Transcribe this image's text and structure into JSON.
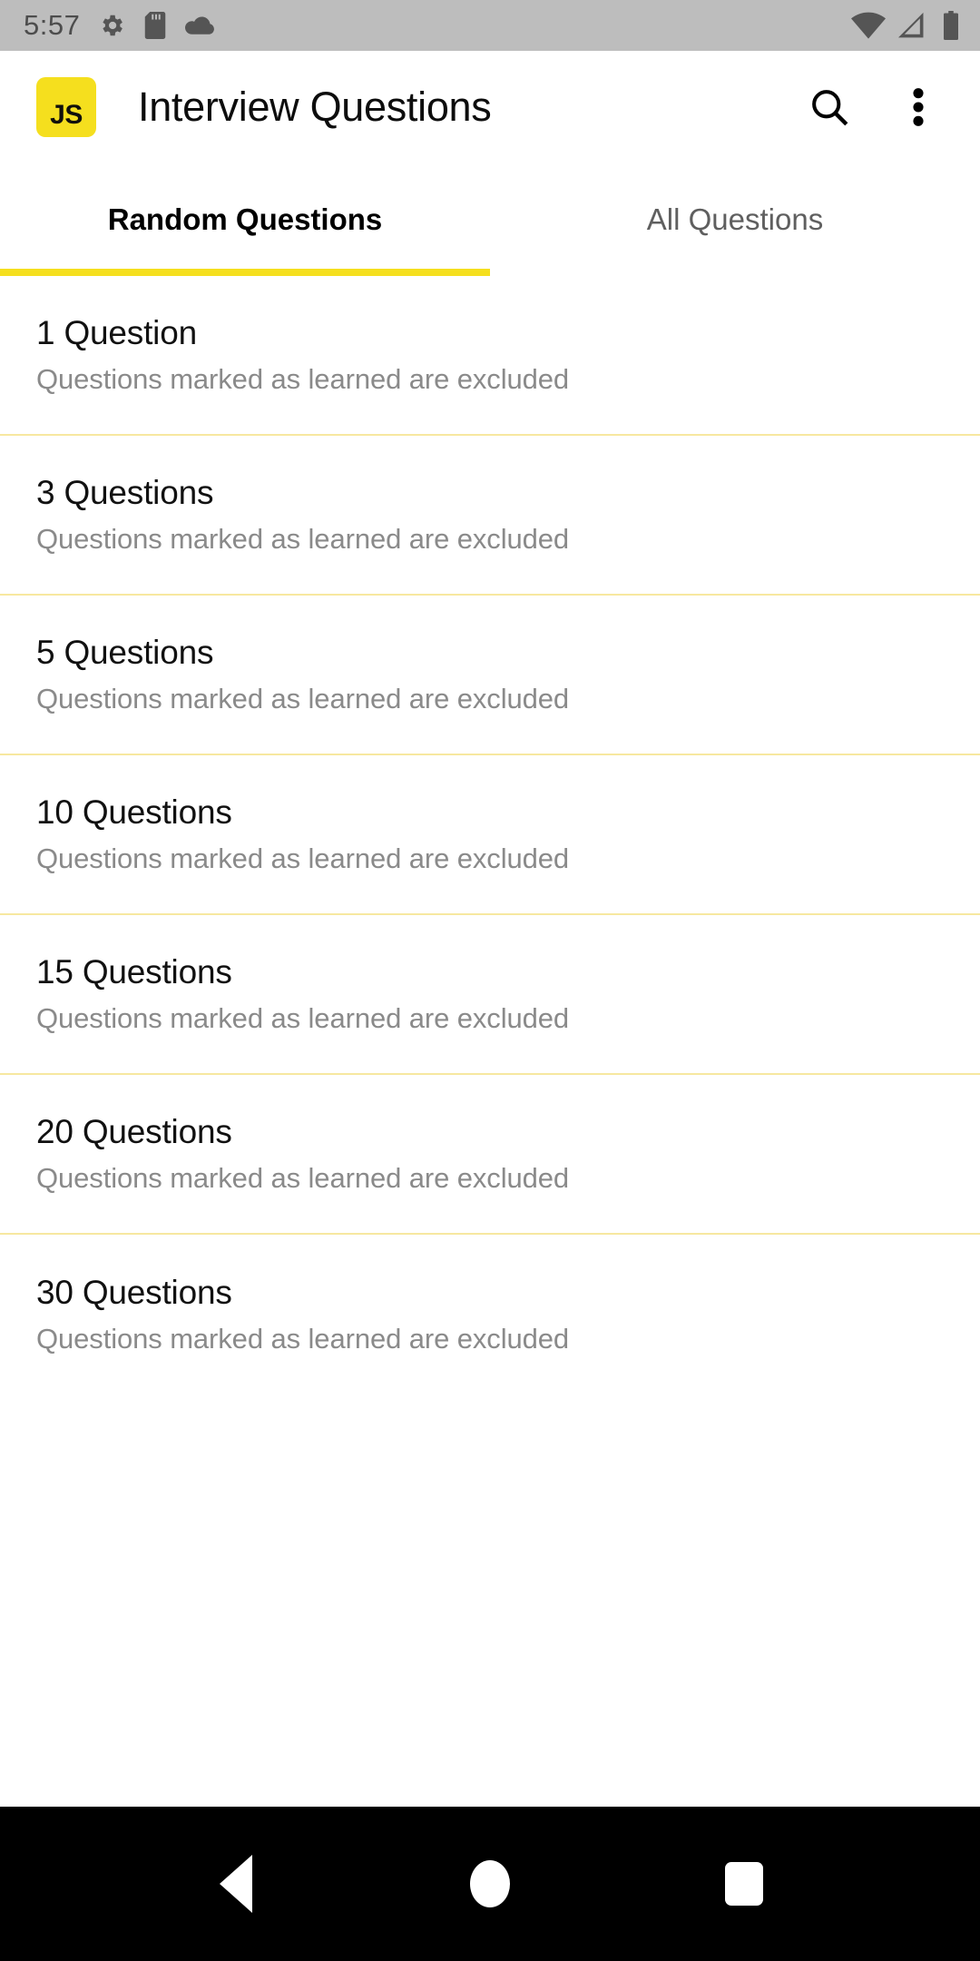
{
  "status_bar": {
    "time": "5:57",
    "left_icons": [
      "gear-icon",
      "sd-card-icon",
      "cloud-icon"
    ],
    "right_icons": [
      "wifi-icon",
      "cellular-signal-icon",
      "battery-icon"
    ],
    "background_color": "#bdbdbd"
  },
  "app_bar": {
    "logo_text": "JS",
    "logo_color": "#f5df1e",
    "title": "Interview Questions",
    "actions": [
      {
        "name": "search-icon",
        "label": "Search"
      },
      {
        "name": "overflow-menu-icon",
        "label": "More options"
      }
    ]
  },
  "tabs": {
    "items": [
      {
        "label": "Random Questions",
        "active": true
      },
      {
        "label": "All Questions",
        "active": false
      }
    ],
    "indicator_color": "#f5df1e"
  },
  "list": {
    "divider_color": "#f7e8a0",
    "items": [
      {
        "title": "1 Question",
        "subtitle": "Questions marked as learned are excluded"
      },
      {
        "title": "3 Questions",
        "subtitle": "Questions marked as learned are excluded"
      },
      {
        "title": "5 Questions",
        "subtitle": "Questions marked as learned are excluded"
      },
      {
        "title": "10 Questions",
        "subtitle": "Questions marked as learned are excluded"
      },
      {
        "title": "15 Questions",
        "subtitle": "Questions marked as learned are excluded"
      },
      {
        "title": "20 Questions",
        "subtitle": "Questions marked as learned are excluded"
      },
      {
        "title": "30 Questions",
        "subtitle": "Questions marked as learned are excluded"
      }
    ]
  },
  "nav_bar": {
    "buttons": [
      {
        "name": "back-button",
        "label": "Back"
      },
      {
        "name": "home-button",
        "label": "Home"
      },
      {
        "name": "recents-button",
        "label": "Recents"
      }
    ],
    "background_color": "#000000"
  }
}
